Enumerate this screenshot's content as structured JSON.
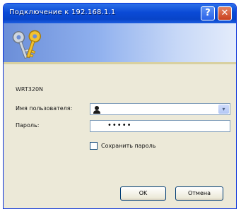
{
  "window": {
    "title": "Подключение к 192.168.1.1",
    "help_label": "?",
    "close_label": "✕"
  },
  "device_name": "WRT320N",
  "form": {
    "username_label": "Имя пользователя:",
    "username_value": "",
    "password_label": "Пароль:",
    "password_value": "•••••",
    "remember_label": "Сохранить пароль",
    "remember_checked": false
  },
  "buttons": {
    "ok": "OK",
    "cancel": "Отмена"
  },
  "colors": {
    "titlebar": "#0a4ad6",
    "dialog_bg": "#ece9d8",
    "close": "#c9401d"
  },
  "icons": {
    "banner": "keys-icon",
    "user": "user-icon",
    "dropdown": "chevron-down-icon"
  }
}
